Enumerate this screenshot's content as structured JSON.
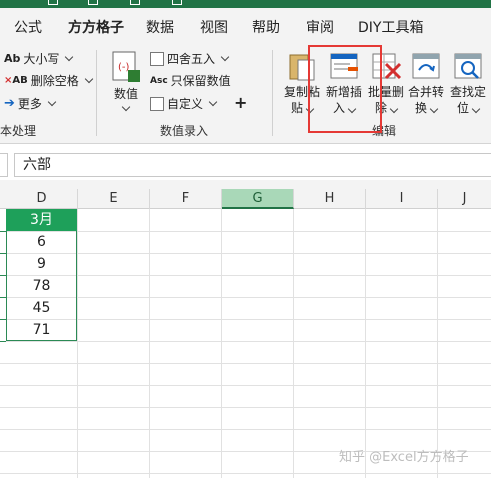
{
  "tabs": [
    {
      "label": "公式"
    },
    {
      "label": "方方格子"
    },
    {
      "label": "数据"
    },
    {
      "label": "视图"
    },
    {
      "label": "帮助"
    },
    {
      "label": "审阅"
    },
    {
      "label": "DIY工具箱"
    }
  ],
  "ribbon": {
    "text_group": {
      "items": [
        "大小写",
        "删除空格",
        "更多"
      ],
      "ab_glyph": "Ab",
      "ab_glyph2": "AB",
      "group_label": "本处理"
    },
    "number_group": {
      "big_button": "数值",
      "items": [
        "四舍五入",
        "只保留数值",
        "自定义"
      ],
      "asc_glyph": "Asc",
      "plus": "+",
      "group_label": "数值录入"
    },
    "edit_group": {
      "buttons": [
        {
          "line1": "复制粘",
          "line2": "贴"
        },
        {
          "line1": "新增插",
          "line2": "入"
        },
        {
          "line1": "批量删",
          "line2": "除"
        },
        {
          "line1": "合并转",
          "line2": "换"
        },
        {
          "line1": "查找定",
          "line2": "位"
        }
      ],
      "group_label": "编辑"
    }
  },
  "formula_bar": {
    "value": "六部"
  },
  "columns": [
    "D",
    "E",
    "F",
    "G",
    "H",
    "I",
    "J"
  ],
  "selected_column": "G",
  "table": {
    "header": "3月",
    "values": [
      "6",
      "9",
      "78",
      "45",
      "71"
    ]
  },
  "watermark": "知乎 @Excel方方格子",
  "colors": {
    "excel_green": "#217346",
    "header_fill": "#1ea05a",
    "highlight": "#e53935"
  }
}
